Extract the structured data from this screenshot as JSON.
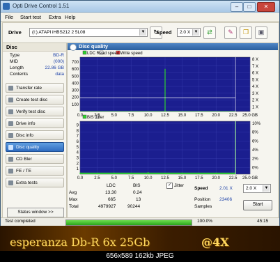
{
  "window": {
    "title": "Opti Drive Control 1.51"
  },
  "menu": [
    "File",
    "Start test",
    "Extra",
    "Help"
  ],
  "toolbar": {
    "drive_label": "Drive",
    "drive_value": "(I:)  ATAPI iHBS212   2 5L08",
    "speed_label": "Speed",
    "speed_value": "2.0 X"
  },
  "disc": {
    "header": "Disc",
    "rows": [
      {
        "k": "Type",
        "v": "BD-R"
      },
      {
        "k": "MID",
        "v": "(000)"
      },
      {
        "k": "Length",
        "v": "22.86 GB"
      },
      {
        "k": "Contents",
        "v": "data"
      }
    ]
  },
  "nav": [
    {
      "label": "Transfer rate"
    },
    {
      "label": "Create test disc"
    },
    {
      "label": "Verify test disc"
    },
    {
      "label": "Drive info"
    },
    {
      "label": "Disc info"
    },
    {
      "label": "Disc quality"
    },
    {
      "label": "CD Bler"
    },
    {
      "label": "FE / TE"
    },
    {
      "label": "Extra tests"
    }
  ],
  "status_window_label": "Status window >>",
  "panel": {
    "title": "Disc quality"
  },
  "chart_data": [
    {
      "type": "line",
      "legend": [
        "LDC",
        "Read speed",
        "Write speed"
      ],
      "x_ticks": [
        "0.0",
        "2.5",
        "5.0",
        "7.5",
        "10.0",
        "12.5",
        "15.0",
        "17.5",
        "20.0",
        "22.5",
        "25.0 GB"
      ],
      "y_ticks_right": [
        "8 X",
        "7 X",
        "6 X",
        "5 X",
        "4 X",
        "3 X",
        "2 X",
        "1 X"
      ],
      "y_ticks_left": [
        "700",
        "600",
        "500",
        "400",
        "300",
        "200",
        "100"
      ],
      "ylim": [
        0,
        800
      ],
      "x": [
        0.0,
        2.5,
        4.8,
        9.0,
        12.5,
        15.0,
        17.5,
        20.0,
        22.2,
        22.86
      ],
      "values": [
        6,
        5,
        5,
        6,
        628,
        5,
        5,
        5,
        6,
        6
      ],
      "read_speed_x": 2.0
    },
    {
      "type": "line",
      "legend": [
        "BIS",
        "Jitter"
      ],
      "x_ticks": [
        "0.0",
        "2.5",
        "5.0",
        "7.5",
        "10.0",
        "12.5",
        "15.0",
        "17.5",
        "20.0",
        "22.5",
        "25.0 GB"
      ],
      "y_ticks_right": [
        "10%",
        "8%",
        "6%",
        "4%",
        "2%",
        "0%"
      ],
      "y_ticks_left": [
        "9",
        "8",
        "7",
        "6",
        "5",
        "4",
        "3",
        "2",
        "1"
      ],
      "ylim": [
        0,
        10
      ],
      "x": [
        0.0,
        2.5,
        5.0,
        7.5,
        10.0,
        12.5,
        15.0,
        17.5,
        20.0,
        22.86
      ],
      "values": [
        0.3,
        0.2,
        0.3,
        0.2,
        0.4,
        0.2,
        0.3,
        0.2,
        0.3,
        13
      ]
    }
  ],
  "stats": {
    "col_ldc": "LDC",
    "col_bis": "BIS",
    "jitter_label": "Jitter",
    "avg_label": "Avg",
    "avg_ldc": "13.30",
    "avg_bis": "0.24",
    "max_label": "Max",
    "max_ldc": "665",
    "max_bis": "13",
    "total_label": "Total",
    "total_ldc": "4979927",
    "total_bis": "90244",
    "speed_label": "Speed",
    "speed_value": "2.01 X",
    "position_label": "Position",
    "position_value": "23406",
    "samples_label": "Samples",
    "speed_select": "2.0 X",
    "start_label": "Start"
  },
  "status": {
    "text": "Test completed",
    "progress_text": "100.0%",
    "progress": 1.0,
    "time": "45:15"
  },
  "caption": {
    "text": "esperanza Db-R 6x 25Gb",
    "badge": "@4X",
    "meta": "656x589 162kb JPEG"
  },
  "colors": {
    "ldc_bars": "#2fd12f",
    "read_speed": "#ffffff",
    "plot_bg": "#1b1e8f",
    "spike": "#2fd12f"
  }
}
